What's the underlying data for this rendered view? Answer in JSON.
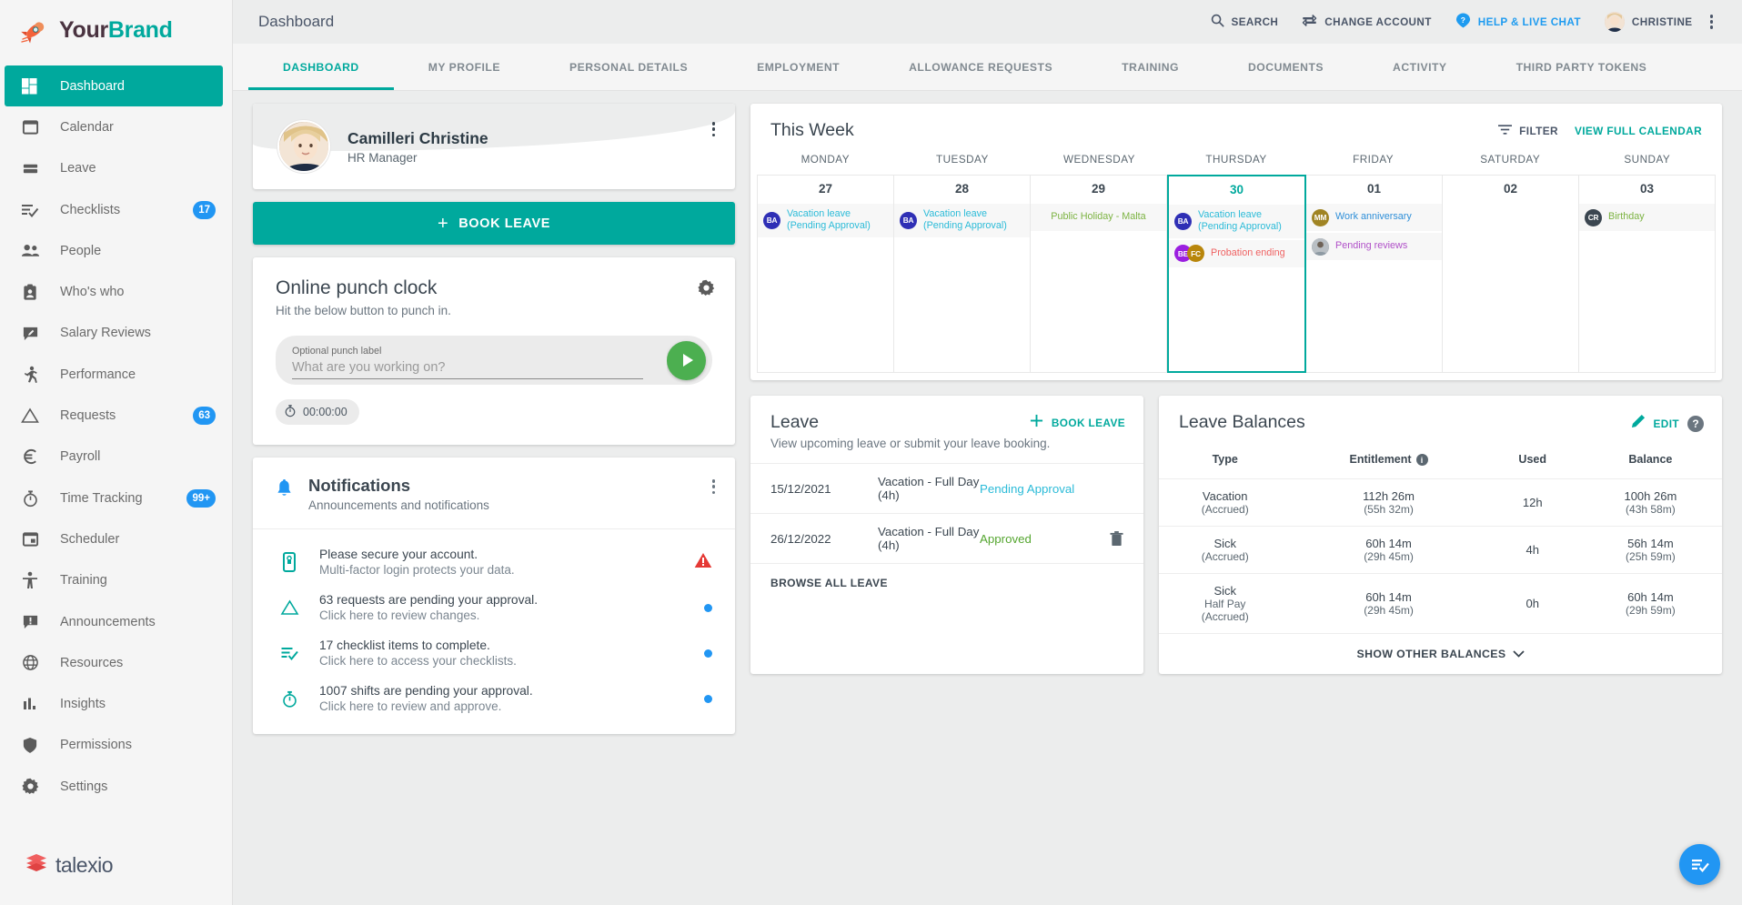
{
  "brand": {
    "part1": "Your",
    "part2": "Brand",
    "logo_icon": "rocket-icon"
  },
  "sidebar": {
    "items": [
      {
        "label": "Dashboard",
        "icon": "dashboard-grid-icon",
        "badge": "",
        "active": true
      },
      {
        "label": "Calendar",
        "icon": "calendar-icon",
        "badge": ""
      },
      {
        "label": "Leave",
        "icon": "leave-card-icon",
        "badge": ""
      },
      {
        "label": "Checklists",
        "icon": "checklist-icon",
        "badge": "17"
      },
      {
        "label": "People",
        "icon": "people-icon",
        "badge": ""
      },
      {
        "label": "Who's who",
        "icon": "id-badge-icon",
        "badge": ""
      },
      {
        "label": "Salary Reviews",
        "icon": "review-comment-icon",
        "badge": ""
      },
      {
        "label": "Performance",
        "icon": "running-person-icon",
        "badge": ""
      },
      {
        "label": "Requests",
        "icon": "triangle-icon",
        "badge": "63"
      },
      {
        "label": "Payroll",
        "icon": "euro-icon",
        "badge": ""
      },
      {
        "label": "Time Tracking",
        "icon": "stopwatch-icon",
        "badge": "99+"
      },
      {
        "label": "Scheduler",
        "icon": "scheduler-calendar-icon",
        "badge": ""
      },
      {
        "label": "Training",
        "icon": "accessibility-person-icon",
        "badge": ""
      },
      {
        "label": "Announcements",
        "icon": "announcement-icon",
        "badge": ""
      },
      {
        "label": "Resources",
        "icon": "globe-icon",
        "badge": ""
      },
      {
        "label": "Insights",
        "icon": "bar-chart-icon",
        "badge": ""
      },
      {
        "label": "Permissions",
        "icon": "shield-icon",
        "badge": ""
      },
      {
        "label": "Settings",
        "icon": "gear-icon",
        "badge": ""
      }
    ],
    "footer_logo": "talexio"
  },
  "topbar": {
    "page_title": "Dashboard",
    "search": "SEARCH",
    "change_account": "CHANGE ACCOUNT",
    "help": "HELP & LIVE CHAT",
    "user": "CHRISTINE"
  },
  "tabs": [
    {
      "label": "DASHBOARD",
      "active": true
    },
    {
      "label": "MY PROFILE"
    },
    {
      "label": "PERSONAL DETAILS"
    },
    {
      "label": "EMPLOYMENT"
    },
    {
      "label": "ALLOWANCE REQUESTS"
    },
    {
      "label": "TRAINING"
    },
    {
      "label": "DOCUMENTS"
    },
    {
      "label": "ACTIVITY"
    },
    {
      "label": "THIRD PARTY TOKENS"
    }
  ],
  "profile": {
    "name": "Camilleri Christine",
    "role": "HR Manager"
  },
  "book_leave_button": "BOOK LEAVE",
  "punch_clock": {
    "title": "Online punch clock",
    "subtitle": "Hit the below button to punch in.",
    "field_label": "Optional punch label",
    "placeholder": "What are you working on?",
    "value": "",
    "timer": "00:00:00"
  },
  "notifications": {
    "title": "Notifications",
    "subtitle": "Announcements and notifications",
    "items": [
      {
        "line1": "Please secure your account.",
        "line2": "Multi-factor login protects your data.",
        "icon": "mobile-lock-icon",
        "indicator": "warning"
      },
      {
        "line1": "63 requests are pending your approval.",
        "line2": "Click here to review changes.",
        "icon": "triangle-icon",
        "indicator": "dot"
      },
      {
        "line1": "17 checklist items to complete.",
        "line2": "Click here to access your checklists.",
        "icon": "checklist-icon",
        "indicator": "dot"
      },
      {
        "line1": "1007 shifts are pending your approval.",
        "line2": "Click here to review and approve.",
        "icon": "stopwatch-icon",
        "indicator": "dot"
      }
    ]
  },
  "week": {
    "title": "This Week",
    "filter": "FILTER",
    "view_full": "VIEW FULL CALENDAR",
    "day_names": [
      "MONDAY",
      "TUESDAY",
      "WEDNESDAY",
      "THURSDAY",
      "FRIDAY",
      "SATURDAY",
      "SUNDAY"
    ],
    "days": [
      {
        "num": "27",
        "today": false,
        "events": [
          {
            "text": "Vacation leave (Pending Approval)",
            "color": "#2bbbd8",
            "avatars": [
              {
                "initials": "BA",
                "color": "#2f2fb5"
              }
            ]
          }
        ]
      },
      {
        "num": "28",
        "today": false,
        "events": [
          {
            "text": "Vacation leave (Pending Approval)",
            "color": "#2bbbd8",
            "avatars": [
              {
                "initials": "BA",
                "color": "#2f2fb5"
              }
            ]
          }
        ]
      },
      {
        "num": "29",
        "today": false,
        "events": [
          {
            "text": "Public Holiday - Malta",
            "color": "#7cb342",
            "avatars": []
          }
        ]
      },
      {
        "num": "30",
        "today": true,
        "events": [
          {
            "text": "Vacation leave (Pending Approval)",
            "color": "#2bbbd8",
            "avatars": [
              {
                "initials": "BA",
                "color": "#2f2fb5"
              }
            ]
          },
          {
            "text": "Probation ending",
            "color": "#ef6262",
            "avatars": [
              {
                "initials": "BE",
                "color": "#9b1fe0"
              },
              {
                "initials": "FC",
                "color": "#b8860b"
              }
            ]
          }
        ]
      },
      {
        "num": "01",
        "today": false,
        "events": [
          {
            "text": "Work anniversary",
            "color": "#2f8fd8",
            "avatars": [
              {
                "initials": "MM",
                "color": "#a08423"
              }
            ]
          },
          {
            "text": "Pending reviews",
            "color": "#b050c8",
            "avatars": [
              {
                "initials": "",
                "color": "#8f9ba5",
                "photo": true
              }
            ]
          }
        ]
      },
      {
        "num": "02",
        "today": false,
        "events": []
      },
      {
        "num": "03",
        "today": false,
        "events": [
          {
            "text": "Birthday",
            "color": "#7cb342",
            "avatars": [
              {
                "initials": "CR",
                "color": "#3b4650"
              }
            ]
          }
        ]
      }
    ]
  },
  "leave": {
    "title": "Leave",
    "subtitle": "View upcoming leave or submit your leave booking.",
    "action": "BOOK LEAVE",
    "rows": [
      {
        "date": "15/12/2021",
        "desc": "Vacation - Full Day (4h)",
        "status": "Pending Approval",
        "status_kind": "pending",
        "deletable": false
      },
      {
        "date": "26/12/2022",
        "desc": "Vacation - Full Day (4h)",
        "status": "Approved",
        "status_kind": "approved",
        "deletable": true
      }
    ],
    "browse_all": "BROWSE ALL LEAVE"
  },
  "balances": {
    "title": "Leave Balances",
    "edit": "EDIT",
    "columns": [
      "Type",
      "Entitlement",
      "Used",
      "Balance"
    ],
    "rows": [
      {
        "type": "Vacation",
        "type_sub": "(Accrued)",
        "entitlement": "112h 26m",
        "entitlement_sub": "(55h 32m)",
        "used": "12h",
        "used_sub": "",
        "balance": "100h 26m",
        "balance_sub": "(43h 58m)"
      },
      {
        "type": "Sick",
        "type_sub": "(Accrued)",
        "entitlement": "60h 14m",
        "entitlement_sub": "(29h 45m)",
        "used": "4h",
        "used_sub": "",
        "balance": "56h 14m",
        "balance_sub": "(25h 59m)"
      },
      {
        "type": "Sick",
        "type_sub": "Half Pay\n(Accrued)",
        "entitlement": "60h 14m",
        "entitlement_sub": "(29h 45m)",
        "used": "0h",
        "used_sub": "",
        "balance": "60h 14m",
        "balance_sub": "(29h 59m)"
      }
    ],
    "show_other": "SHOW OTHER BALANCES"
  },
  "fab": {
    "icon": "checklist-icon"
  },
  "colors": {
    "accent": "#00a99d",
    "blue": "#2196f3",
    "green": "#4caf50",
    "warning": "#e53935"
  }
}
